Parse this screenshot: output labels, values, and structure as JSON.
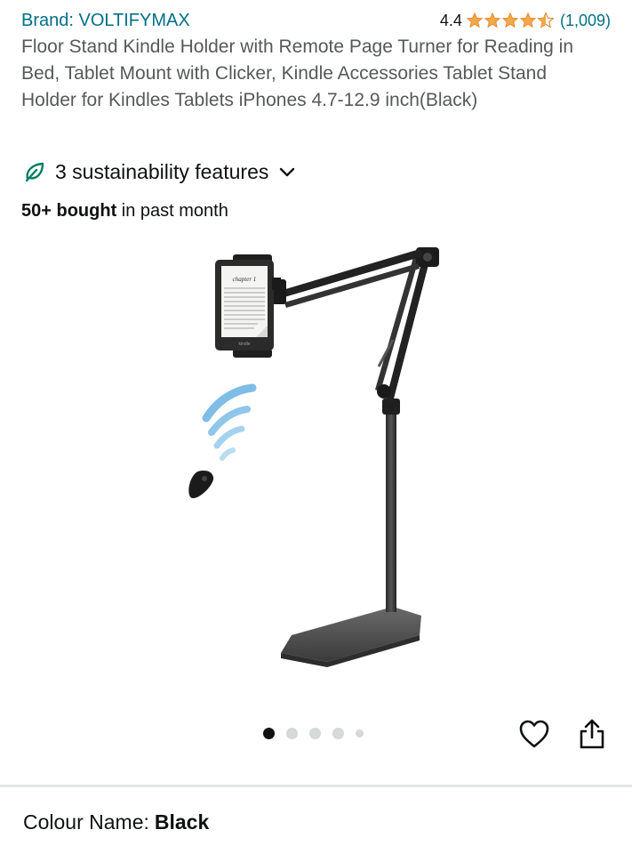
{
  "product": {
    "brand_label": "Brand: VOLTIFYMAX",
    "rating": "4.4",
    "rating_stars": 4.4,
    "rating_count": "(1,009)",
    "title": "Floor Stand Kindle Holder with Remote Page Turner for Reading in Bed, Tablet Mount with Clicker, Kindle Accessories Tablet Stand Holder for Kindles Tablets iPhones 4.7-12.9 inch(Black)"
  },
  "sustainability": {
    "label": "3 sustainability features",
    "icon": "leaf-icon"
  },
  "purchases": {
    "count": "50+ bought",
    "suffix": " in past month"
  },
  "gallery": {
    "screen_text": "chapter 1",
    "device_brand": "kindle",
    "dots_total": 5,
    "active_index": 0
  },
  "actions": {
    "wishlist_icon": "heart-icon",
    "share_icon": "share-icon"
  },
  "variant": {
    "label": "Colour Name:",
    "value": "Black"
  },
  "colors": {
    "link": "#007185",
    "star": "#f3a847",
    "secondary_text": "#565959",
    "leaf": "#067d62"
  }
}
